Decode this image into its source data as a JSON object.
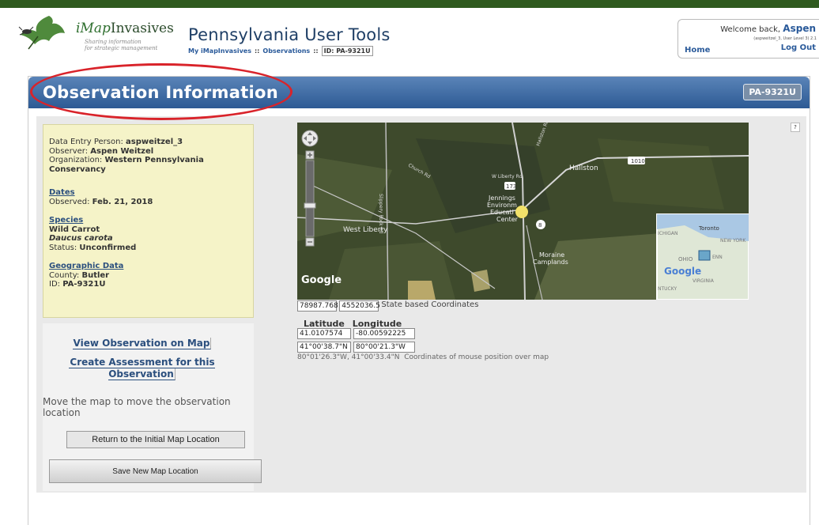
{
  "header": {
    "brand_prefix": "iMap",
    "brand_suffix": "Invasives",
    "tagline_1": "Sharing information",
    "tagline_2": "for strategic management",
    "site_title": "Pennsylvania User Tools",
    "breadcrumb": [
      {
        "label": "My iMapInvasives"
      },
      {
        "label": "Observations"
      },
      {
        "label": "ID: PA-9321U"
      }
    ],
    "welcome_prefix": "Welcome back,",
    "user_name": "Aspen",
    "user_meta": "(aspweitzel_3, User Level 3) 2.1",
    "home_label": "Home",
    "logout_label": "Log Out"
  },
  "panel": {
    "title": "Observation Information",
    "id_badge": "PA-9321U"
  },
  "info": {
    "entry_label": "Data Entry Person:",
    "entry_value": "aspweitzel_3",
    "observer_label": "Observer:",
    "observer_value": "Aspen Weitzel",
    "org_label": "Organization:",
    "org_value": "Western Pennsylvania Conservancy",
    "dates_heading": "Dates",
    "observed_label": "Observed:",
    "observed_value": "Feb. 21, 2018",
    "species_heading": "Species",
    "common_name": "Wild Carrot",
    "sci_name": "Daucus carota",
    "status_label": "Status:",
    "status_value": "Unconfirmed",
    "geo_heading": "Geographic Data",
    "county_label": "County:",
    "county_value": "Butler",
    "id_label": "ID:",
    "id_value": "PA-9321U"
  },
  "actions": {
    "view_map": "View Observation on Map",
    "create_assessment": "Create Assessment for this Observation",
    "move_hint": "Move the map to move the observation location",
    "return_btn": "Return to the Initial Map Location",
    "save_btn": "Save New Map Location"
  },
  "map": {
    "place_hallston": "Hallston",
    "place_west_liberty": "West Liberty",
    "place_jennings": "Jennings Environmental Education Center",
    "place_moraine": "Moraine Camplands",
    "road_1010": "1010",
    "road_173": "173",
    "road_8": "8",
    "road_church": "Church Rd",
    "road_slippery": "Slippery Rock Rd",
    "road_liberty": "W Liberty Rd",
    "road_hallston": "Hallston Rd",
    "attribution": "Google",
    "inset_toronto": "Toronto",
    "inset_newyork": "NEW YORK",
    "inset_ohio": "OHIO",
    "inset_michigan": "ICHIGAN",
    "inset_penn": "ENN",
    "inset_virginia": "VIRGINIA",
    "inset_kentucky": "NTUCKY",
    "inset_google": "Google",
    "help": "?"
  },
  "coords": {
    "state_x": "78987.768",
    "state_y": "4552036.5",
    "state_label": "State based Coordinates",
    "lat_header": "Latitude",
    "lon_header": "Longitude",
    "lat_decimal": "41.0107574",
    "lon_decimal": "-80.00592225",
    "lat_dms": "41°00'38.7\"N",
    "lon_dms": "80°00'21.3\"W",
    "mouse_coords": "80°01'26.3\"W, 41°00'33.4\"N",
    "mouse_label": "Coordinates of mouse position over map"
  },
  "colors": {
    "topbar": "#2f5a1e",
    "titlebar": "#2d5a94",
    "info_bg": "#f5f3c8",
    "highlight": "#d9232a"
  }
}
